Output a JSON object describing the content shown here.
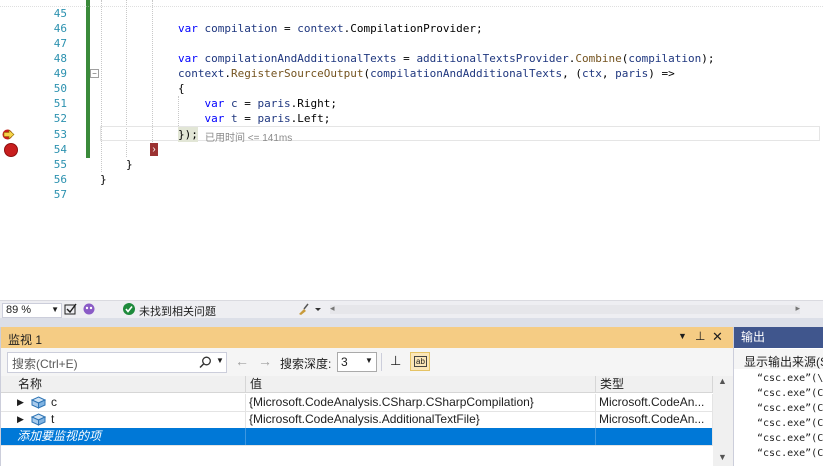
{
  "editor": {
    "lines": [
      {
        "num": "45",
        "code": ""
      },
      {
        "num": "46",
        "code": "var compilation = context.CompilationProvider;"
      },
      {
        "num": "47",
        "code": ""
      },
      {
        "num": "48",
        "code": "var compilationAndAdditionalTexts = additionalTextsProvider.Combine(compilation);"
      },
      {
        "num": "49",
        "code": "context.RegisterSourceOutput(compilationAndAdditionalTexts, (ctx, paris) =>"
      },
      {
        "num": "50",
        "code": "{"
      },
      {
        "num": "51",
        "code": "    var c = paris.Right;"
      },
      {
        "num": "52",
        "code": "    var t = paris.Left;"
      },
      {
        "num": "53",
        "code": "});"
      },
      {
        "num": "54",
        "code": ""
      },
      {
        "num": "55",
        "code": "}"
      },
      {
        "num": "56",
        "code": "}"
      },
      {
        "num": "57",
        "code": ""
      }
    ],
    "perf_tip": "已用时间 <= 141ms"
  },
  "status_bar": {
    "zoom": "89 %",
    "issues_text": "未找到相关问题"
  },
  "watch": {
    "title": "监视 1",
    "search_placeholder": "搜索(Ctrl+E)",
    "search_depth_label": "搜索深度:",
    "search_depth_value": "3",
    "columns": [
      "名称",
      "值",
      "类型"
    ],
    "rows": [
      {
        "name": "c",
        "value": "{Microsoft.CodeAnalysis.CSharp.CSharpCompilation}",
        "type": "Microsoft.CodeAn..."
      },
      {
        "name": "t",
        "value": "{Microsoft.CodeAnalysis.AdditionalTextFile}",
        "type": "Microsoft.CodeAn..."
      }
    ],
    "add_item_text": "添加要监视的项"
  },
  "output": {
    "title": "输出",
    "source_label": "显示输出来源(S",
    "lines": [
      "“csc.exe”(\\",
      "“csc.exe”(C",
      "“csc.exe”(C",
      "“csc.exe”(C",
      "“csc.exe”(C",
      "“csc.exe”(C"
    ]
  },
  "colors": {
    "accent_selected": "#0078d7",
    "watch_title_bg": "#f5cc84",
    "output_title_bg": "#40568d",
    "breakpoint": "#c81e1e",
    "line_number": "#2b91af"
  }
}
